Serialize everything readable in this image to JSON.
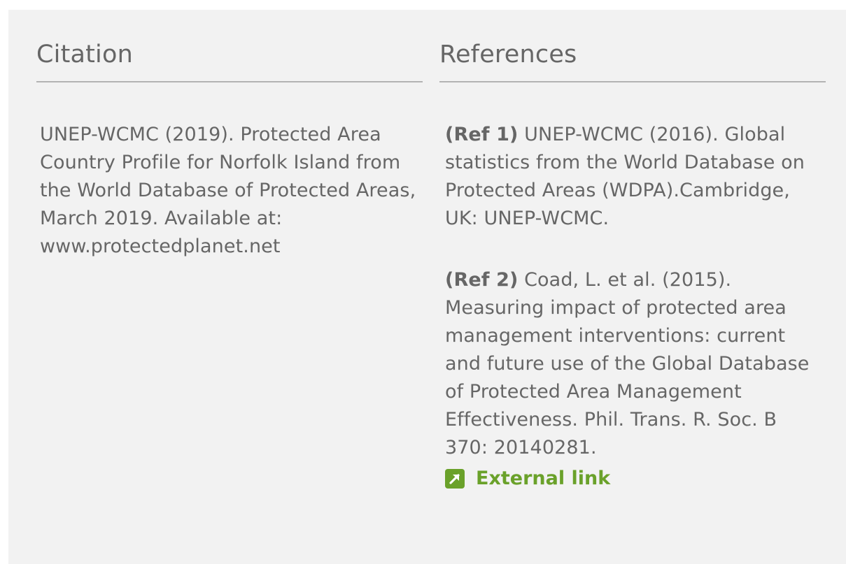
{
  "citation": {
    "heading": "Citation",
    "text": "UNEP-WCMC (2019). Protected Area Country Profile for Norfolk Island from the World Database of Protected Areas, March 2019. Available at: www.protectedplanet.net"
  },
  "references": {
    "heading": "References",
    "items": [
      {
        "label": "(Ref 1)",
        "text": " UNEP-WCMC (2016). Global statistics from the World Database on Protected Areas (WDPA).Cambridge, UK: UNEP-WCMC."
      },
      {
        "label": "(Ref 2)",
        "text": " Coad, L. et al. (2015). Measuring impact of protected area management interventions: current and future use of the Global Database of Protected Area Management Effectiveness. Phil. Trans. R. Soc. B 370: 20140281."
      }
    ],
    "external_link": {
      "label": "External link",
      "icon": "external-link-icon"
    }
  },
  "colors": {
    "panel_background": "#f2f2f2",
    "text": "#666666",
    "divider": "#b3b3b3",
    "link": "#6aa12a"
  }
}
